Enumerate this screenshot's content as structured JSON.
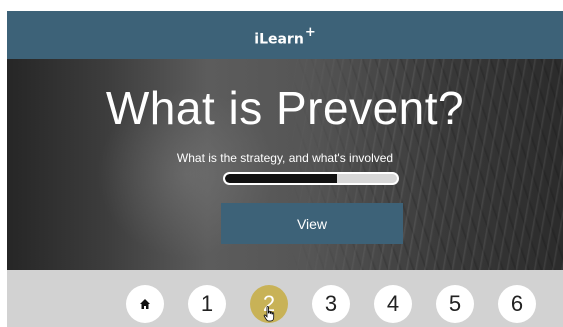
{
  "header": {
    "brand": "iLearn",
    "brand_mark": "+"
  },
  "hero": {
    "title": "What is Prevent?",
    "subtitle": "What is the strategy, and what's involved",
    "progress_fraction": 0.65,
    "button_label": "View"
  },
  "nav": {
    "home_icon": "home-icon",
    "pages": [
      "1",
      "2",
      "3",
      "4",
      "5",
      "6"
    ],
    "active_page": "2"
  },
  "colors": {
    "header_bg": "#3d6278",
    "button_bg": "#3d6278",
    "active_page": "#c8b257",
    "nav_bg": "#d2d2d2"
  }
}
